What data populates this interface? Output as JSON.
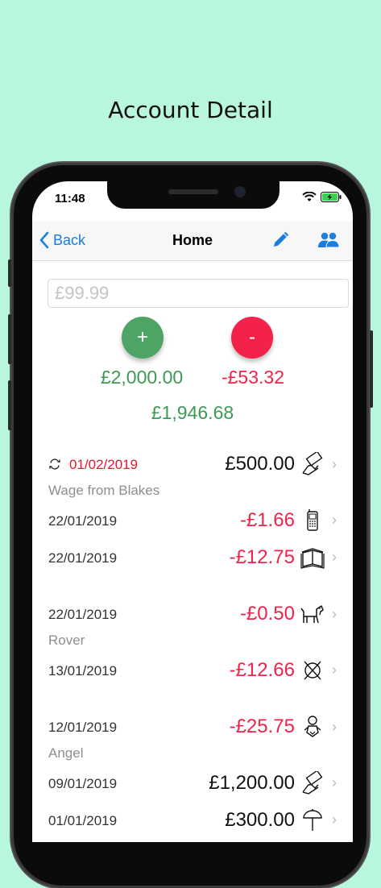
{
  "header": {
    "title": "Account Detail"
  },
  "status_bar": {
    "time": "11:48"
  },
  "nav": {
    "back_label": "Back",
    "title": "Home"
  },
  "entry": {
    "placeholder": "£99.99"
  },
  "buttons": {
    "plus_label": "+",
    "minus_label": "-"
  },
  "totals": {
    "income": "£2,000.00",
    "expense": "-£53.32",
    "balance": "£1,946.68"
  },
  "transactions": [
    {
      "date": "01/02/2019",
      "amount": "£500.00",
      "description": "Wage from Blakes",
      "recurring": true,
      "icon": "cash-hand-icon"
    },
    {
      "date": "22/01/2019",
      "amount": "-£1.66",
      "description": "",
      "icon": "mobile-phone-icon"
    },
    {
      "date": "22/01/2019",
      "amount": "-£12.75",
      "description": "",
      "icon": "book-icon"
    },
    {
      "date": "22/01/2019",
      "amount": "-£0.50",
      "description": "Rover",
      "icon": "dog-icon"
    },
    {
      "date": "13/01/2019",
      "amount": "-£12.66",
      "description": "",
      "icon": "no-washing-icon"
    },
    {
      "date": "12/01/2019",
      "amount": "-£25.75",
      "description": "Angel",
      "icon": "baby-icon"
    },
    {
      "date": "09/01/2019",
      "amount": "£1,200.00",
      "description": "",
      "icon": "cash-hand-icon"
    },
    {
      "date": "01/01/2019",
      "amount": "£300.00",
      "description": "",
      "icon": "beach-icon"
    }
  ],
  "colors": {
    "background": "#b9f6de",
    "income": "#3b9b55",
    "expense": "#f2224b",
    "link": "#1a7de0",
    "overdue_date": "#e0192f"
  }
}
